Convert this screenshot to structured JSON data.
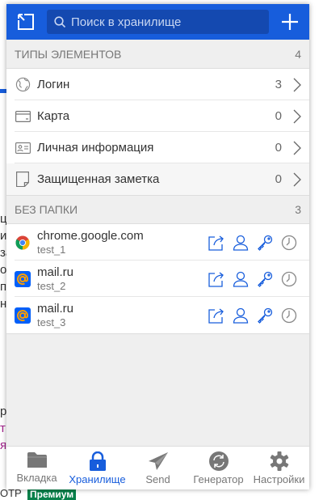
{
  "background": {
    "fragments": [
      "ц",
      "и",
      "за",
      "о",
      "п",
      "н",
      "р",
      "т",
      "я",
      "ОТР"
    ],
    "premium_badge": "Премиум"
  },
  "header": {
    "search_placeholder": "Поиск в хранилище"
  },
  "types_section": {
    "title": "ТИПЫ ЭЛЕМЕНТОВ",
    "count": "4",
    "items": [
      {
        "label": "Логин",
        "count": "3",
        "icon": "globe-icon"
      },
      {
        "label": "Карта",
        "count": "0",
        "icon": "credit-card-icon"
      },
      {
        "label": "Личная информация",
        "count": "0",
        "icon": "id-card-icon"
      },
      {
        "label": "Защищенная заметка",
        "count": "0",
        "icon": "sticky-note-icon"
      }
    ]
  },
  "no_folder_section": {
    "title": "БЕЗ ПАПКИ",
    "count": "3",
    "items": [
      {
        "name": "chrome.google.com",
        "user": "test_1",
        "icon": "chrome-icon"
      },
      {
        "name": "mail.ru",
        "user": "test_2",
        "icon": "mailru-icon"
      },
      {
        "name": "mail.ru",
        "user": "test_3",
        "icon": "mailru-icon"
      }
    ]
  },
  "nav": {
    "tabs": [
      {
        "label": "Вкладка",
        "icon": "folder-icon"
      },
      {
        "label": "Хранилище",
        "icon": "lock-icon",
        "active": true
      },
      {
        "label": "Send",
        "icon": "paper-plane-icon"
      },
      {
        "label": "Генератор",
        "icon": "refresh-icon"
      },
      {
        "label": "Настройки",
        "icon": "gear-icon"
      }
    ]
  },
  "colors": {
    "brand": "#175ddc",
    "action_icon": "#175ddc",
    "premium": "#07804a"
  }
}
